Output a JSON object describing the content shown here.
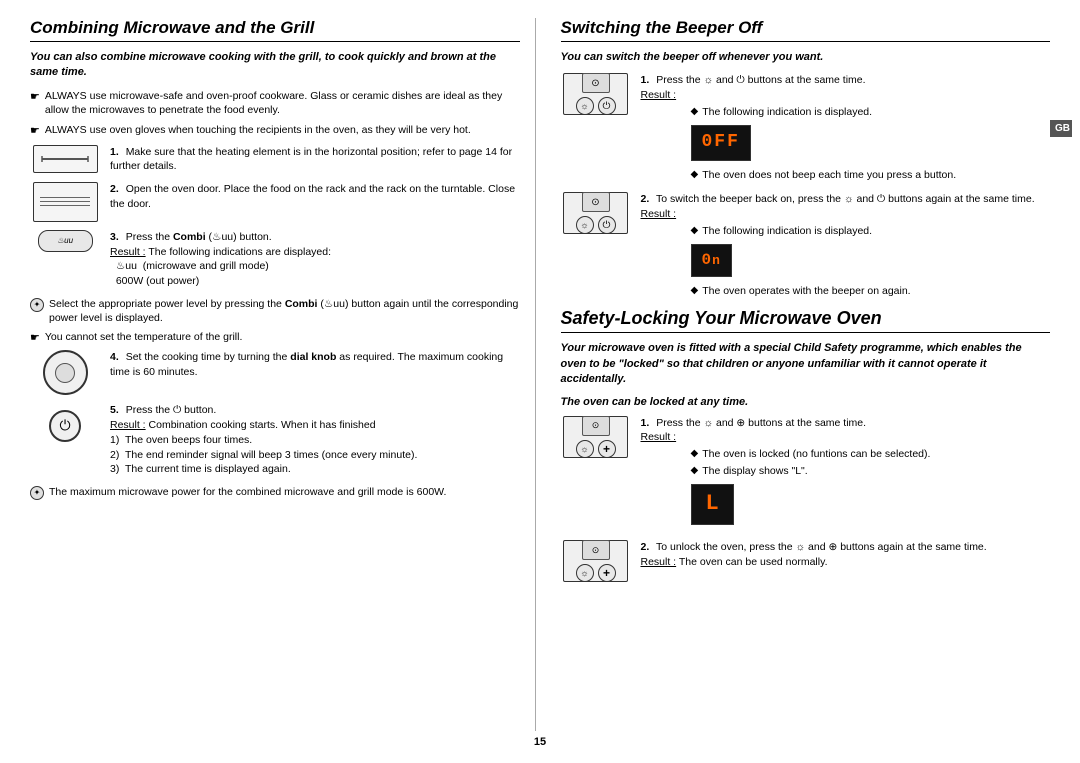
{
  "left": {
    "title": "Combining Microwave and the Grill",
    "subtitle": "You can also combine microwave cooking with the grill, to cook quickly and brown at the same time.",
    "bullets": [
      "ALWAYS use microwave-safe and oven-proof cookware. Glass or ceramic dishes are ideal as they allow the microwaves to penetrate the food evenly.",
      "ALWAYS use oven gloves when touching the recipients in the oven, as they will be very hot."
    ],
    "steps": [
      {
        "num": "1.",
        "text": "Make sure that the heating element is in the horizontal position; refer to page 14 for further details."
      },
      {
        "num": "2.",
        "text": "Open the oven door. Place the food on the rack and the rack on the turntable. Close the door."
      },
      {
        "num": "3.",
        "text": "Press the Combi (♨uu) button.",
        "result_label": "Result :",
        "result_text": "The following indications are displayed: ♨uu (microwave and grill mode) 600W (out power)"
      }
    ],
    "note1": "Select the appropriate power level by pressing the Combi (♨uu) button again until the corresponding power level is displayed.",
    "note2": "You cannot set the temperature of the grill.",
    "steps2": [
      {
        "num": "4.",
        "text": "Set the cooking time by turning the dial knob as required. The maximum cooking time is 60 minutes."
      },
      {
        "num": "5.",
        "text": "Press the ⏻ button.",
        "result_label": "Result :",
        "result_lines": [
          "Combination cooking starts. When it has finished",
          "1)  The oven beeps four times.",
          "2)  The end reminder signal will beep 3 times (once every minute).",
          "3)  The current time is displayed again."
        ]
      }
    ],
    "footnote": "The maximum microwave power for the combined microwave and grill mode is 600W."
  },
  "right": {
    "title1": "Switching the Beeper Off",
    "subtitle1": "You can switch the beeper off whenever you want.",
    "beeper_steps": [
      {
        "num": "1.",
        "text": "Press the ☼ and ⏻ buttons at the same time.",
        "result_label": "Result :",
        "result_lines": [
          "The following indication is displayed.",
          "display_off",
          "The oven does not beep each time you press a button."
        ]
      },
      {
        "num": "2.",
        "text": "To switch the beeper back on, press the ☼ and ⏻ buttons again at the same time.",
        "result_label": "Result :",
        "result_lines": [
          "The following indication is displayed.",
          "display_on",
          "The oven operates with the beeper on again."
        ]
      }
    ],
    "title2": "Safety-Locking Your Microwave Oven",
    "subtitle2": "Your microwave oven is fitted with a special Child Safety programme, which enables the oven to be \"locked\" so that children or anyone unfamiliar with it cannot operate it accidentally.",
    "subtitle2b": "The oven can be locked at any time.",
    "lock_steps": [
      {
        "num": "1.",
        "text": "Press the ☼ and ⊕ buttons at the same time.",
        "result_label": "Result :",
        "result_lines": [
          "The oven is locked (no funtions can be selected).",
          "The display shows \"L\".",
          "display_L"
        ]
      },
      {
        "num": "2.",
        "text": "To unlock the oven, press the ☼ and ⊕ buttons again at the same time.",
        "result_label": "Result :",
        "result_line": "The oven can be used normally."
      }
    ]
  },
  "page_number": "15",
  "gb_label": "GB"
}
